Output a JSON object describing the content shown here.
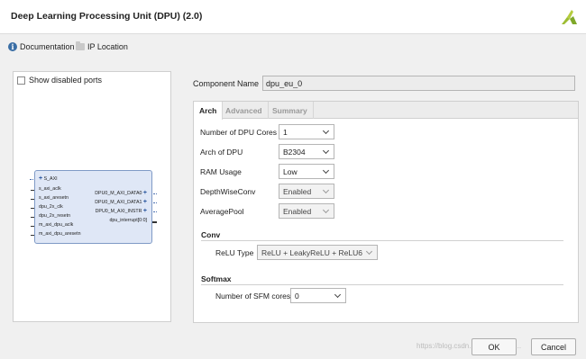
{
  "window": {
    "title": "Deep Learning Processing Unit (DPU) (2.0)",
    "logo_icon": "xilinx-logo-icon",
    "logo_color": "#9dbd32"
  },
  "links": {
    "documentation": "Documentation",
    "ip_location": "IP Location"
  },
  "left_panel": {
    "show_disabled_ports": "Show disabled ports",
    "block": {
      "left_pins": [
        "S_AXI",
        "s_axi_aclk",
        "s_axi_aresetn",
        "dpu_2x_clk",
        "dpu_2x_resetn",
        "m_axi_dpu_aclk",
        "m_axi_dpu_aresetn"
      ],
      "right_pins": [
        "DPU0_M_AXI_DATA0",
        "DPU0_M_AXI_DATA1",
        "DPU0_M_AXI_INSTR",
        "dpu_interrupt[0:0]"
      ]
    }
  },
  "component": {
    "label": "Component Name",
    "value": "dpu_eu_0"
  },
  "tabs": [
    "Arch",
    "Advanced",
    "Summary"
  ],
  "arch": {
    "num_cores": {
      "label": "Number of DPU Cores",
      "value": "1"
    },
    "arch_of_dpu": {
      "label": "Arch of DPU",
      "value": "B2304"
    },
    "ram_usage": {
      "label": "RAM Usage",
      "value": "Low"
    },
    "depthwise": {
      "label": "DepthWiseConv",
      "value": "Enabled"
    },
    "avgpool": {
      "label": "AveragePool",
      "value": "Enabled"
    }
  },
  "conv": {
    "title": "Conv",
    "relu_label": "ReLU Type",
    "relu_value": "ReLU + LeakyReLU + ReLU6"
  },
  "softmax": {
    "title": "Softmax",
    "sfm_label": "Number of SFM cores",
    "sfm_value": "0"
  },
  "buttons": {
    "ok": "OK",
    "cancel": "Cancel"
  },
  "watermark": "https://blog.csdn.net/weixin_45..."
}
